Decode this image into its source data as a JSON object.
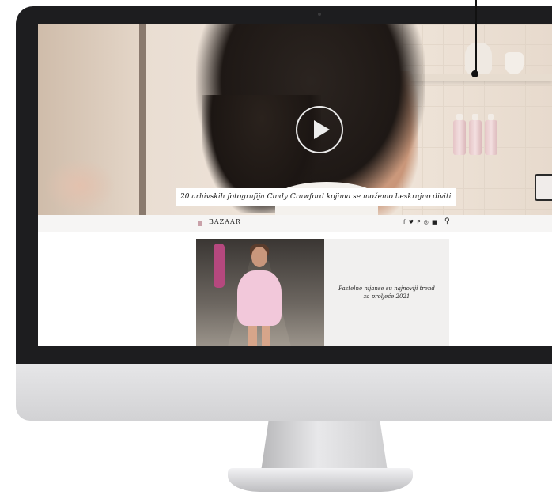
{
  "hero": {
    "caption": "20 arhivskih fotografija Cindy Crawford kojima se možemo beskrajno diviti",
    "play_icon": "play-icon"
  },
  "nav": {
    "logo": "BAZAAR",
    "socials": "f ♥ P ◎ ■",
    "search_icon": "search-icon"
  },
  "article": {
    "title": "Pastelne nijanse su najnoviji trend za proljeće 2021"
  },
  "colors": {
    "bezel": "#1d1d1f",
    "accent": "#c9a1a9",
    "article_bg": "#f1f0ef"
  }
}
